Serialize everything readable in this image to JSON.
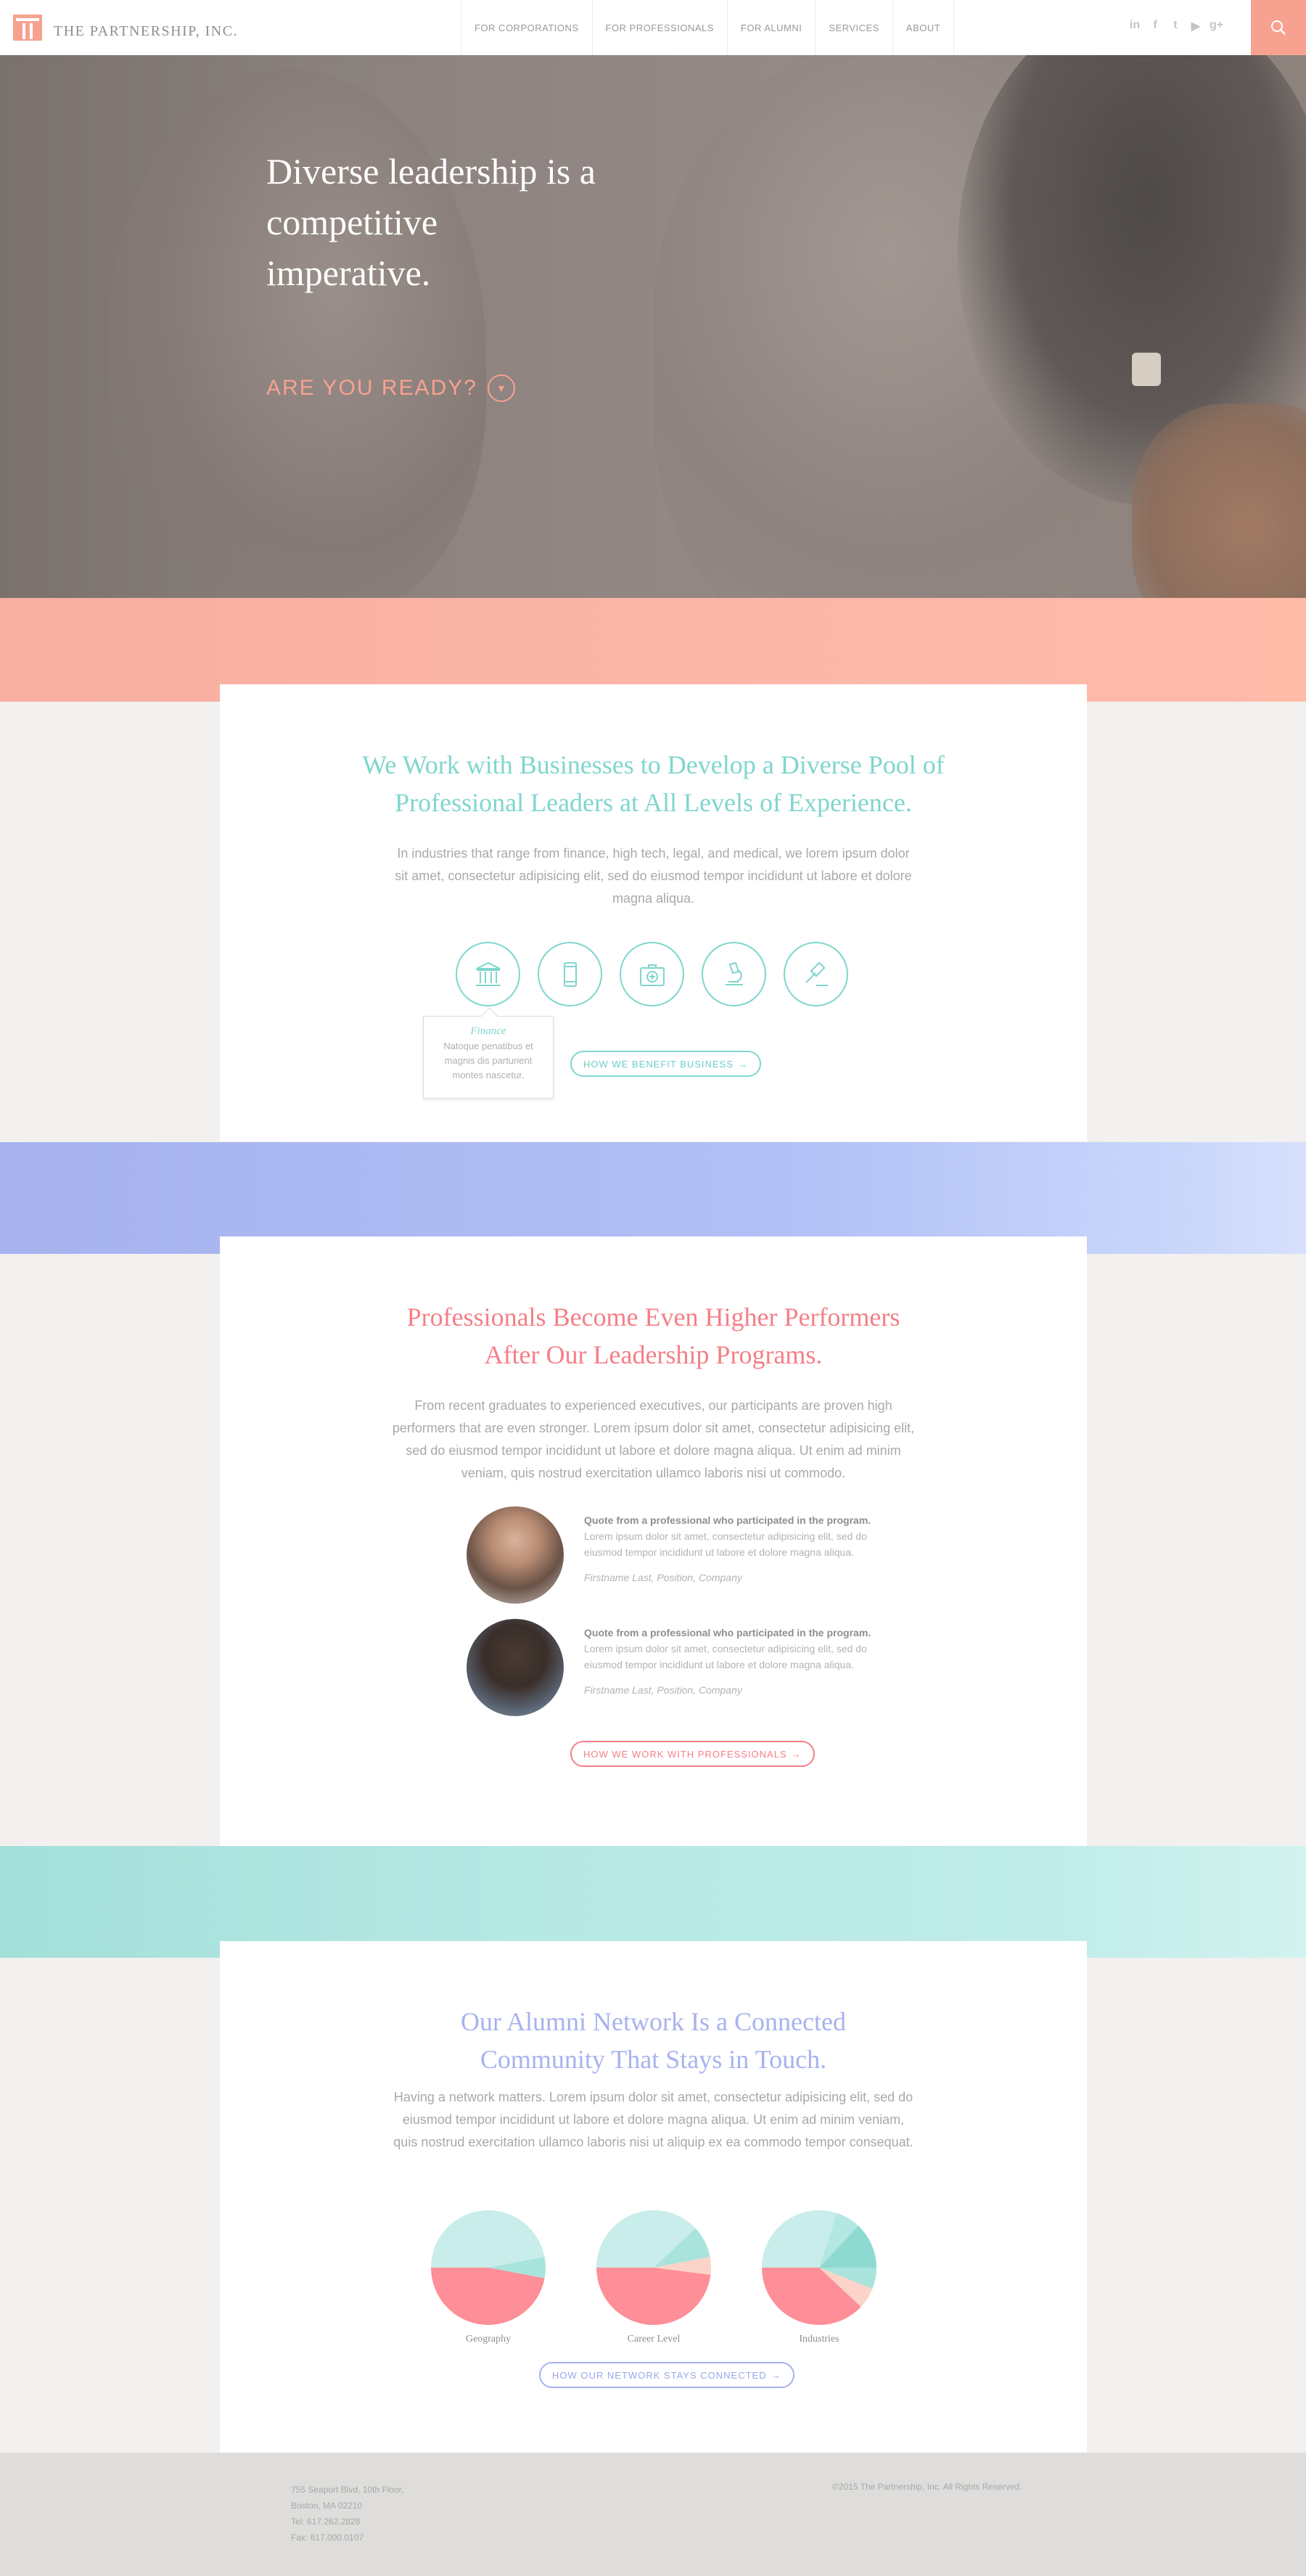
{
  "header": {
    "logo_text": "THE PARTNERSHIP, INC.",
    "nav": [
      {
        "label": "FOR CORPORATIONS"
      },
      {
        "label": "FOR PROFESSIONALS"
      },
      {
        "label": "FOR ALUMNI"
      },
      {
        "label": "SERVICES"
      },
      {
        "label": "ABOUT"
      }
    ],
    "socials": [
      "in",
      "f",
      "t",
      "▶",
      "g+"
    ],
    "accent_color": "#f7a291"
  },
  "hero": {
    "title": "Diverse leadership is a competitive imperative.",
    "cta": "ARE YOU READY?"
  },
  "business": {
    "title": "We Work with Businesses to Develop a Diverse Pool of Professional Leaders at All Levels of Experience.",
    "body": "In industries that range from finance, high tech, legal, and medical, we lorem ipsum dolor sit amet, consectetur adipisicing elit, sed do eiusmod tempor incididunt ut labore et dolore magna aliqua.",
    "icons": [
      "bank-icon",
      "mobile-icon",
      "medical-kit-icon",
      "microscope-icon",
      "gavel-icon"
    ],
    "tooltip_title": "Finance",
    "tooltip_text": "Natoque penatibus et magnis dis parturient montes nascetur.",
    "button": "HOW WE BENEFIT BUSINESS",
    "color": "#7fd6cd"
  },
  "professionals": {
    "title": "Professionals Become Even Higher Performers After Our Leadership Programs.",
    "body": "From recent graduates to experienced executives, our participants are proven high performers that are even stronger. Lorem ipsum dolor sit amet, consectetur adipisicing elit, sed do eiusmod tempor incididunt ut labore et dolore magna aliqua. Ut enim ad minim veniam, quis nostrud exercitation ullamco laboris nisi ut commodo.",
    "testimonials": [
      {
        "quote_title": "Quote from a professional who participated in the program.",
        "quote_body": "Lorem ipsum dolor sit amet, consectetur adipisicing elit, sed do eiusmod tempor incididunt ut labore et dolore magna aliqua.",
        "author": "Firstname Last, Position, Company"
      },
      {
        "quote_title": "Quote from a professional who participated in the program.",
        "quote_body": "Lorem ipsum dolor sit amet, consectetur adipisicing elit, sed do eiusmod tempor incididunt ut labore et dolore magna aliqua.",
        "author": "Firstname Last, Position, Company"
      }
    ],
    "button": "HOW WE WORK WITH PROFESSIONALS",
    "color": "#f47f87"
  },
  "alumni": {
    "title": "Our Alumni Network Is a Connected Community That Stays in Touch.",
    "body": "Having a network matters. Lorem ipsum dolor sit amet, consectetur adipisicing elit, sed do eiusmod tempor incididunt ut labore et dolore magna aliqua. Ut enim ad minim veniam, quis nostrud exercitation ullamco laboris nisi ut aliquip ex ea commodo tempor consequat.",
    "button": "HOW OUR NETWORK STAYS CONNECTED",
    "color": "#a7b2ee"
  },
  "chart_data": [
    {
      "type": "pie",
      "title": "Geography",
      "slices": [
        {
          "value": 47,
          "color": "#c9edea"
        },
        {
          "value": 6,
          "color": "#a8e3dc"
        },
        {
          "value": 47,
          "color": "#fe8e97"
        }
      ]
    },
    {
      "type": "pie",
      "title": "Career Level",
      "slices": [
        {
          "value": 38,
          "color": "#c9edea"
        },
        {
          "value": 9,
          "color": "#a8e3dc"
        },
        {
          "value": 5,
          "color": "#fcd3c9"
        },
        {
          "value": 48,
          "color": "#fe8e97"
        }
      ]
    },
    {
      "type": "pie",
      "title": "Industries",
      "slices": [
        {
          "value": 30,
          "color": "#c9edea"
        },
        {
          "value": 7,
          "color": "#b3e7e1"
        },
        {
          "value": 13,
          "color": "#8ed9d0"
        },
        {
          "value": 6,
          "color": "#a8e3dc"
        },
        {
          "value": 6,
          "color": "#fcd3c9"
        },
        {
          "value": 38,
          "color": "#fe8e97"
        }
      ]
    }
  ],
  "footer": {
    "address": [
      "755 Seaport Blvd, 10th Floor,",
      "Boston, MA 02210",
      "Tel: 617.262.2828",
      "Fax: 617.000.0107"
    ],
    "copyright": "©2015 The Partnership, Inc. All Rights Reserved."
  }
}
